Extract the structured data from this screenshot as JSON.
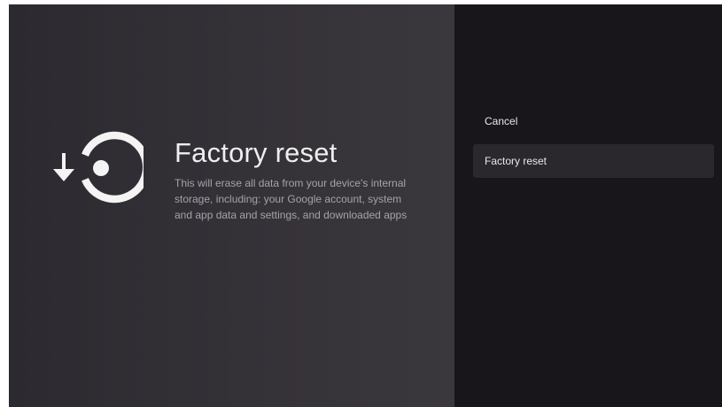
{
  "screen": {
    "title": "Factory reset",
    "description": "This will erase all data from your device's internal storage, including: your Google account, system and app data and settings, and downloaded apps",
    "icon": "restore-icon"
  },
  "menu": {
    "items": [
      {
        "label": "Cancel",
        "focused": false
      },
      {
        "label": "Factory reset",
        "focused": true
      }
    ]
  },
  "colors": {
    "left_background": "#353238",
    "right_background": "#18161a",
    "focused_item": "#2a282d",
    "text_primary": "#eeeeee",
    "text_secondary": "#a5a2a8"
  }
}
